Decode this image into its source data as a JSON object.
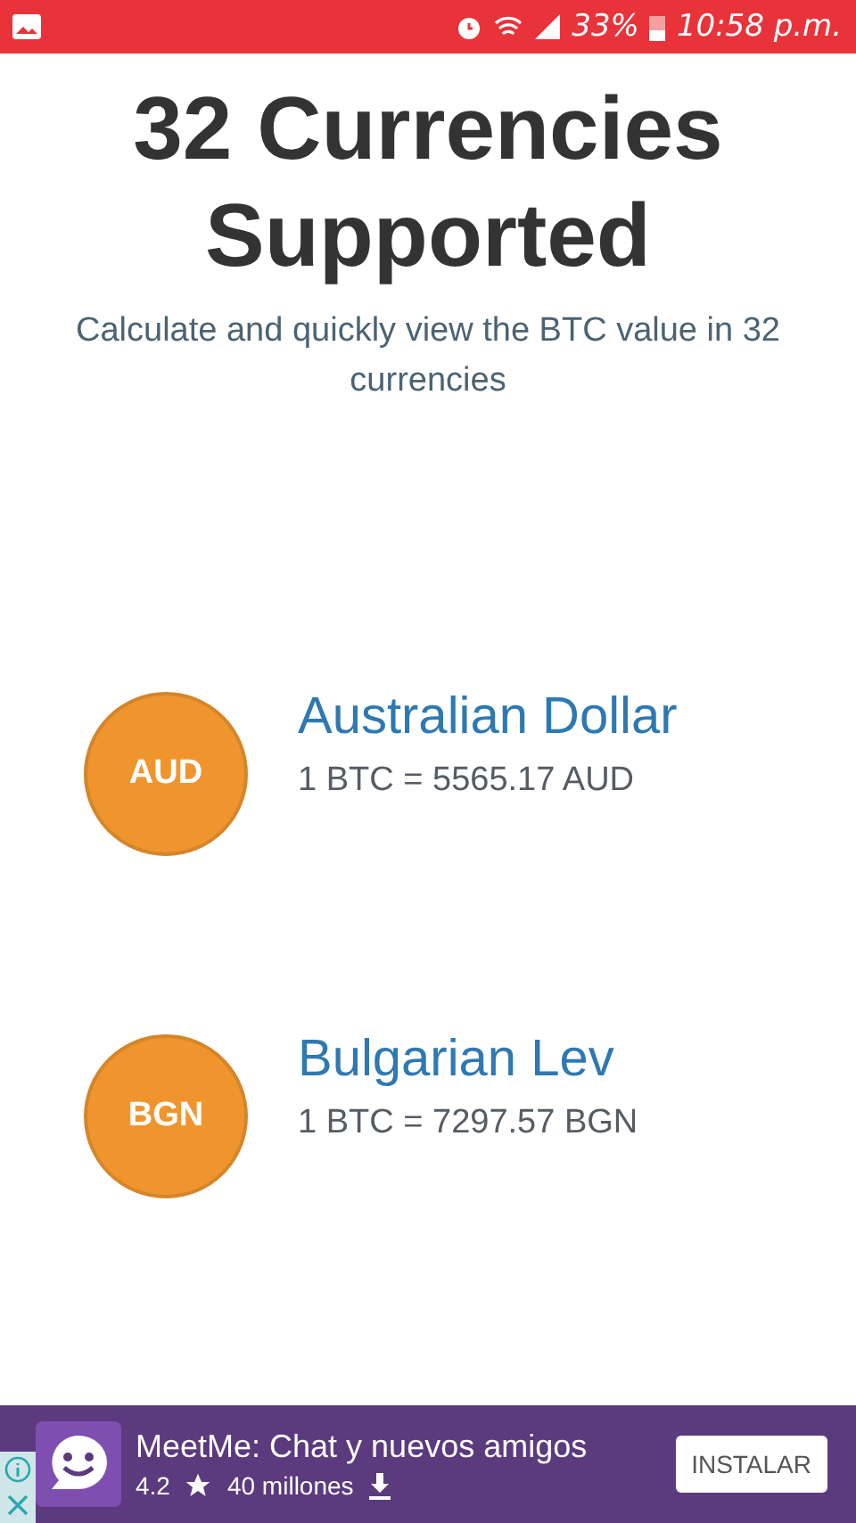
{
  "status_bar": {
    "battery": "33%",
    "time": "10:58 p.m."
  },
  "title": "32 Currencies Supported",
  "subtitle": "Calculate and quickly view the BTC value in 32 currencies",
  "currencies": [
    {
      "code": "AUD",
      "name": "Australian Dollar",
      "rate": "1 BTC = 5565.17 AUD"
    },
    {
      "code": "BGN",
      "name": "Bulgarian Lev",
      "rate": "1 BTC = 7297.57 BGN"
    }
  ],
  "ad": {
    "title": "MeetMe: Chat y nuevos amigos",
    "rating": "4.2",
    "installs": "40 millones",
    "button": "INSTALAR"
  }
}
